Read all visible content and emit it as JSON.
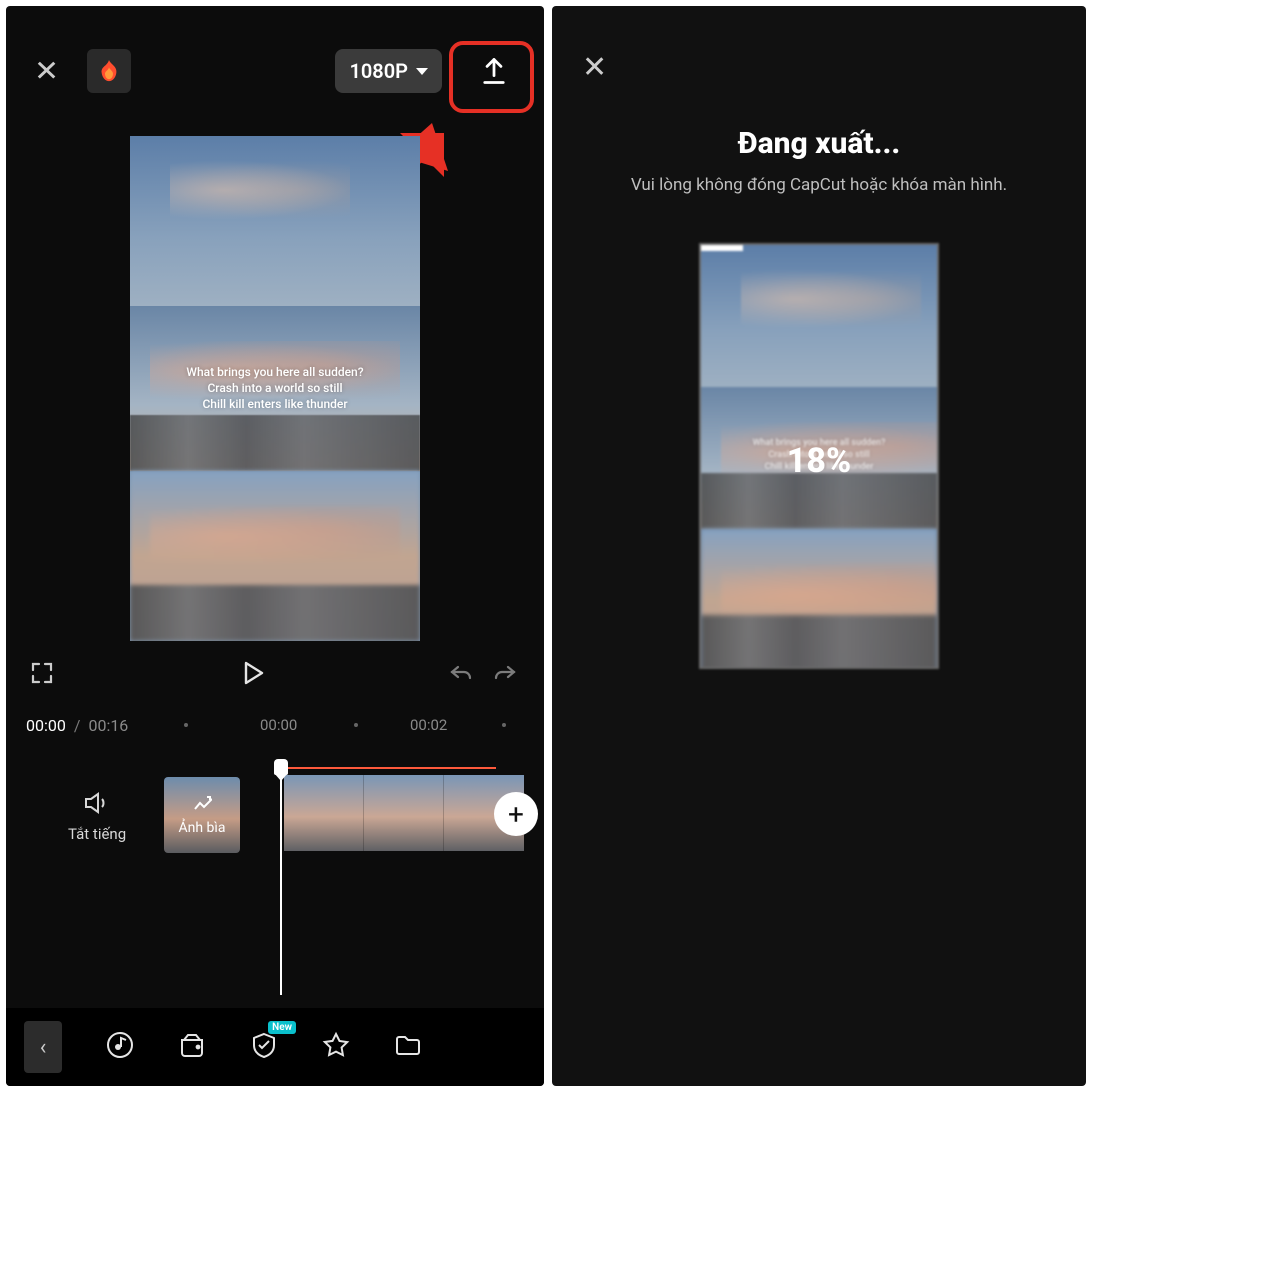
{
  "left": {
    "resolution_label": "1080P",
    "preview_text_l1": "What brings you here all sudden?",
    "preview_text_l2": "Crash into a world so still",
    "preview_text_l3": "Chill kill enters like thunder",
    "time_current": "00:00",
    "time_separator": "/",
    "time_total": "00:16",
    "ticks": {
      "t0": "00:00",
      "t1": "00:02"
    },
    "mute_label": "Tắt tiếng",
    "cover_label": "Ảnh bìa",
    "add_label": "+",
    "new_badge": "New"
  },
  "right": {
    "title": "Đang xuất...",
    "subtitle": "Vui lòng không đóng CapCut hoặc khóa màn hình.",
    "percent": "18%",
    "progress_width": "18%"
  },
  "colors": {
    "highlight": "#e63025",
    "accent": "#ff5a3c",
    "badge": "#0ac0cc"
  }
}
